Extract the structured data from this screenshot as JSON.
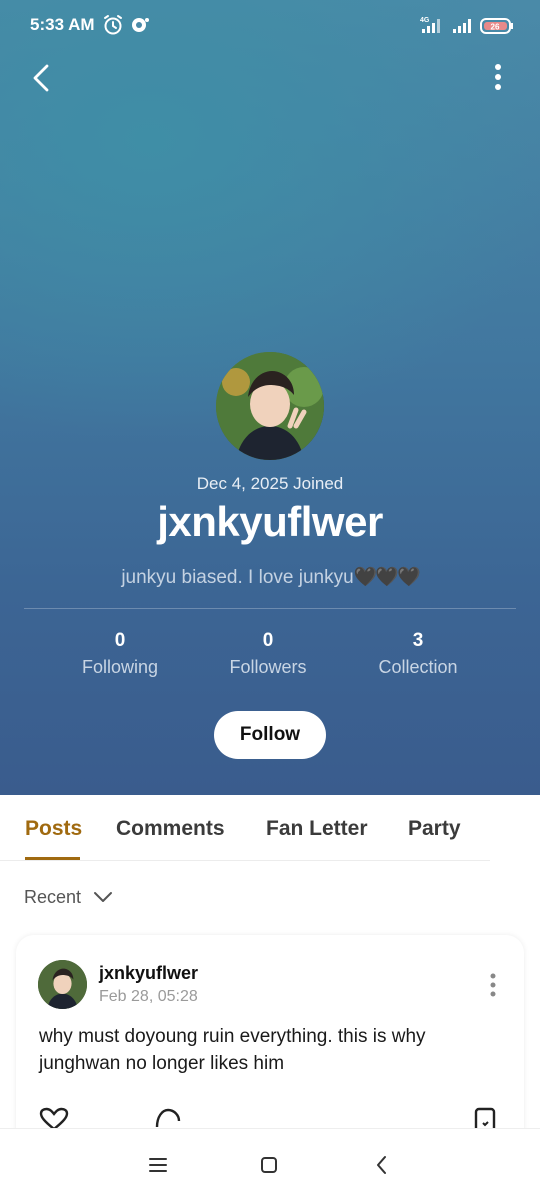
{
  "status_bar": {
    "time": "5:33 AM",
    "icons": [
      "alarm-icon",
      "sync-icon",
      "signal-4g-icon",
      "signal-icon",
      "battery-icon"
    ],
    "network": "4G",
    "battery": "26"
  },
  "header": {
    "back_icon": "chevron-left-icon",
    "more_icon": "more-vertical-icon"
  },
  "profile": {
    "joined": "Dec 4, 2025 Joined",
    "username": "jxnkyuflwer",
    "bio": "junkyu biased. I love junkyu",
    "bio_hearts": "🖤🖤🖤",
    "stats": [
      {
        "value": "0",
        "label": "Following"
      },
      {
        "value": "0",
        "label": "Followers"
      },
      {
        "value": "3",
        "label": "Collection"
      }
    ],
    "follow_label": "Follow"
  },
  "tabs": {
    "items": [
      {
        "label": "Posts",
        "active": true
      },
      {
        "label": "Comments",
        "active": false
      },
      {
        "label": "Fan Letter",
        "active": false
      },
      {
        "label": "Party",
        "active": false
      }
    ]
  },
  "sort": {
    "label": "Recent"
  },
  "posts": [
    {
      "user": "jxnkyuflwer",
      "date": "Feb 28, 05:28",
      "text": "why must doyoung ruin everything. this is why junghwan no longer likes him"
    }
  ],
  "colors": {
    "accent": "#a06a10",
    "hero_top": "#4a8aa8",
    "hero_bottom": "#3a5c8d"
  }
}
